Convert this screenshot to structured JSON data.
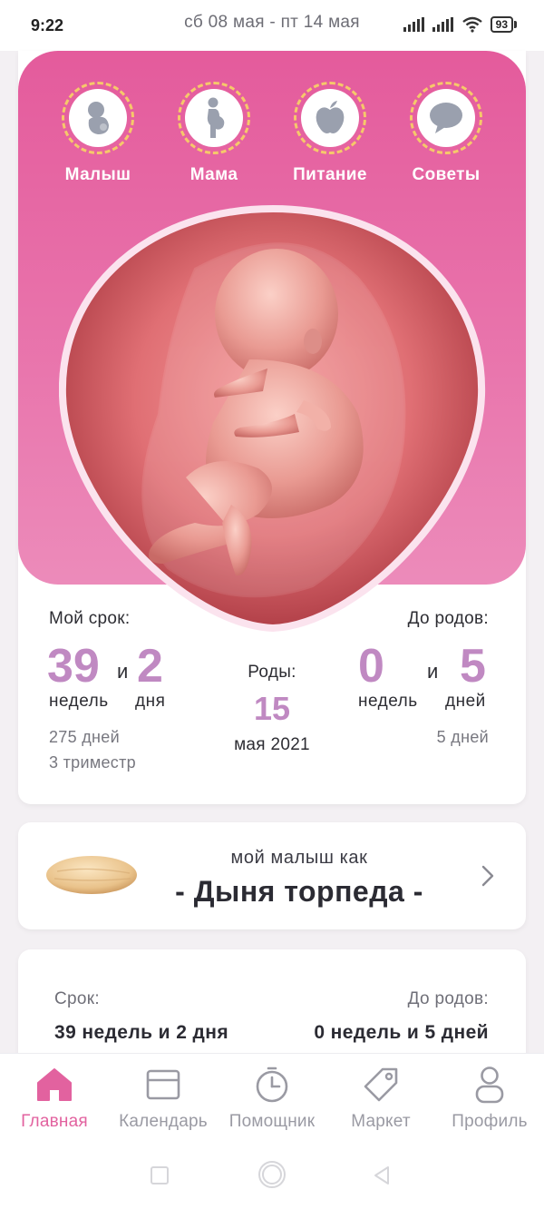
{
  "status": {
    "time": "9:22",
    "dates": "сб 08 мая - пт 14 мая",
    "battery": "93"
  },
  "categories": [
    {
      "label": "Малыш",
      "icon": "baby-icon"
    },
    {
      "label": "Мама",
      "icon": "pregnant-woman-icon"
    },
    {
      "label": "Питание",
      "icon": "apple-icon"
    },
    {
      "label": "Советы",
      "icon": "chat-bubble-icon"
    }
  ],
  "stats": {
    "my_term_label": "Мой срок:",
    "weeks_value": "39",
    "and": "и",
    "days_value": "2",
    "weeks_unit": "недель",
    "days_unit": "дня",
    "total_days": "275 дней",
    "trimester": "3 триместр",
    "birth_label": "Роды:",
    "birth_day": "15",
    "birth_month_year": "мая 2021",
    "to_birth_label": "До родов:",
    "left_weeks": "0",
    "left_days": "5",
    "left_weeks_unit": "недель",
    "left_days_unit": "дней",
    "left_total": "5 дней"
  },
  "fruit": {
    "subtitle": "мой малыш как",
    "title": "- Дыня торпеда -"
  },
  "info": {
    "term_label": "Срок:",
    "term_value": "39 недель и 2 дня",
    "to_birth_label": "До родов:",
    "to_birth_value": "0 недель и 5 дней"
  },
  "nav": [
    {
      "label": "Главная",
      "icon": "home-icon",
      "active": true
    },
    {
      "label": "Календарь",
      "icon": "calendar-icon",
      "active": false
    },
    {
      "label": "Помощник",
      "icon": "timer-icon",
      "active": false
    },
    {
      "label": "Маркет",
      "icon": "tag-icon",
      "active": false
    },
    {
      "label": "Профиль",
      "icon": "person-icon",
      "active": false
    }
  ],
  "colors": {
    "accent": "#e2629f",
    "number": "#c089c2",
    "header_top": "#e45b9c"
  }
}
